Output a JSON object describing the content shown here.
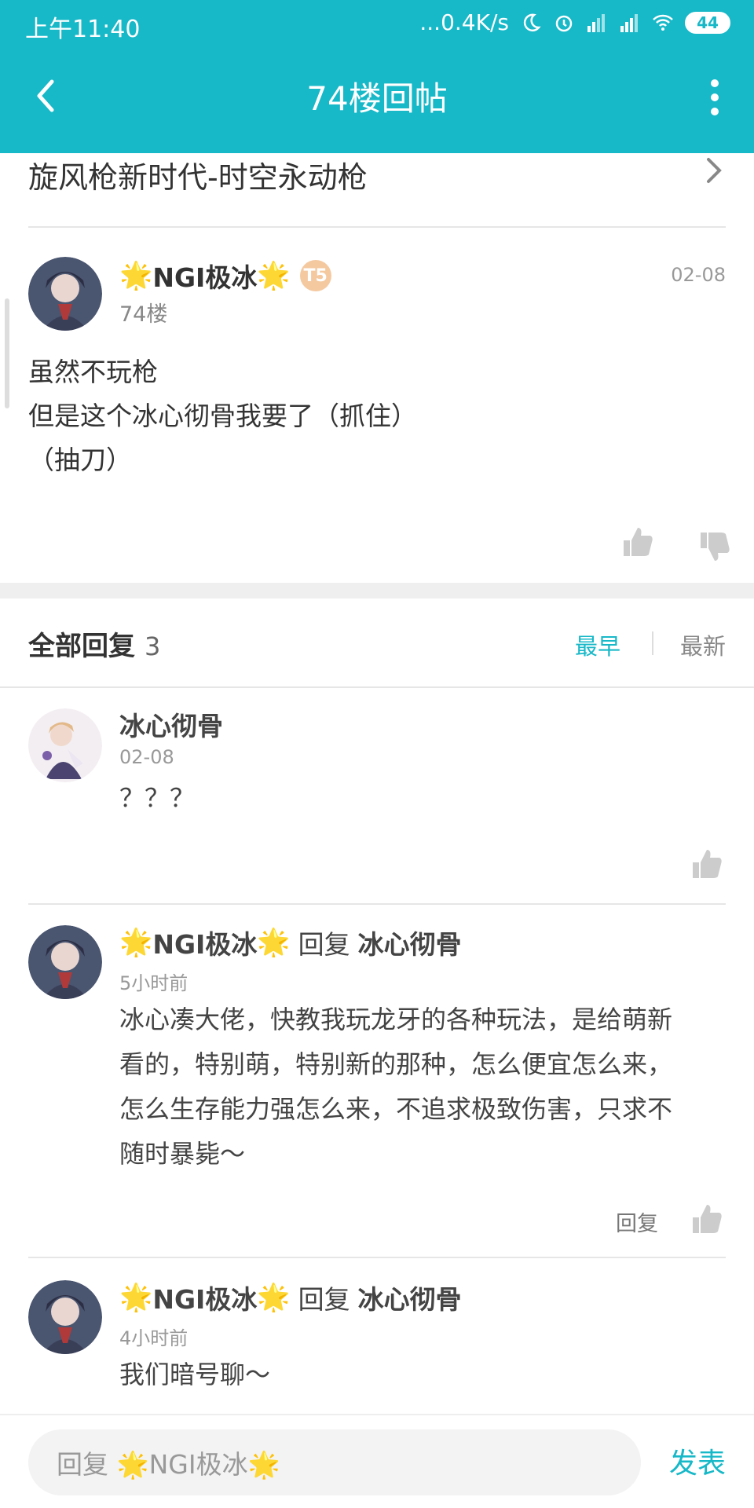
{
  "status_bar": {
    "time": "上午11:40",
    "network_speed": "...0.4K/s",
    "battery": "44"
  },
  "header": {
    "title": "74楼回帖"
  },
  "thread": {
    "title": "旋风枪新时代-时空永动枪"
  },
  "floor_post": {
    "author": "NGI极冰",
    "level_badge": "T5",
    "floor": "74楼",
    "date": "02-08",
    "lines": [
      "虽然不玩枪",
      "但是这个冰心彻骨我要了（抓住）",
      "（抽刀）"
    ]
  },
  "replies_section": {
    "heading": "全部回复",
    "count": "3",
    "sort_earliest": "最早",
    "sort_newest": "最新"
  },
  "replies": [
    {
      "author": "冰心彻骨",
      "time": "02-08",
      "text": "？？？"
    },
    {
      "author": "NGI极冰",
      "reply_word": "回复",
      "reply_to": "冰心彻骨",
      "time": "5小时前",
      "lines": [
        "冰心凑大佬，快教我玩龙牙的各种玩法，是给萌新",
        "看的，特别萌，特别新的那种，怎么便宜怎么来，",
        "怎么生存能力强怎么来，不追求极致伤害，只求不",
        "随时暴毙～"
      ],
      "reply_action": "回复"
    },
    {
      "author": "NGI极冰",
      "reply_word": "回复",
      "reply_to": "冰心彻骨",
      "time": "4小时前",
      "text": "我们暗号聊～"
    }
  ],
  "compose": {
    "placeholder": "回复 🌟NGI极冰🌟",
    "send_label": "发表"
  },
  "colors": {
    "accent": "#17b8c8",
    "star": "#f2b705"
  }
}
